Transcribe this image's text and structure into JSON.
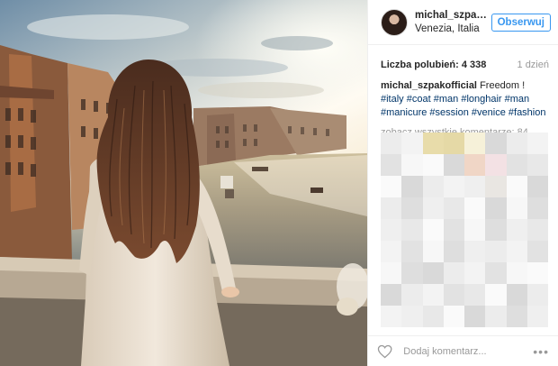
{
  "post": {
    "username": "michal_szpakoffi...",
    "location": "Venezia, Italia",
    "follow_label": "Obserwuj",
    "likes_text": "Liczba polubień: 4 338",
    "time_ago": "1 dzień",
    "caption_user": "michal_szpakofficial",
    "caption_text": "Freedom !",
    "hashtags": [
      "#italy",
      "#coat",
      "#man",
      "#longhair",
      "#man",
      "#manicure",
      "#session",
      "#venice",
      "#fashion"
    ],
    "view_comments": "zobacz wszystkie komentarze: 84",
    "comment_placeholder": "Dodaj komentarz...",
    "more_label": "•••"
  },
  "icons": {
    "avatar": "profile-avatar",
    "heart": "heart-outline-icon",
    "more": "ellipsis-icon"
  },
  "colors": {
    "accent": "#3897f0",
    "hashtag": "#003569",
    "muted": "#999999"
  },
  "image": {
    "description_name": "venice-grand-canal-photo"
  }
}
